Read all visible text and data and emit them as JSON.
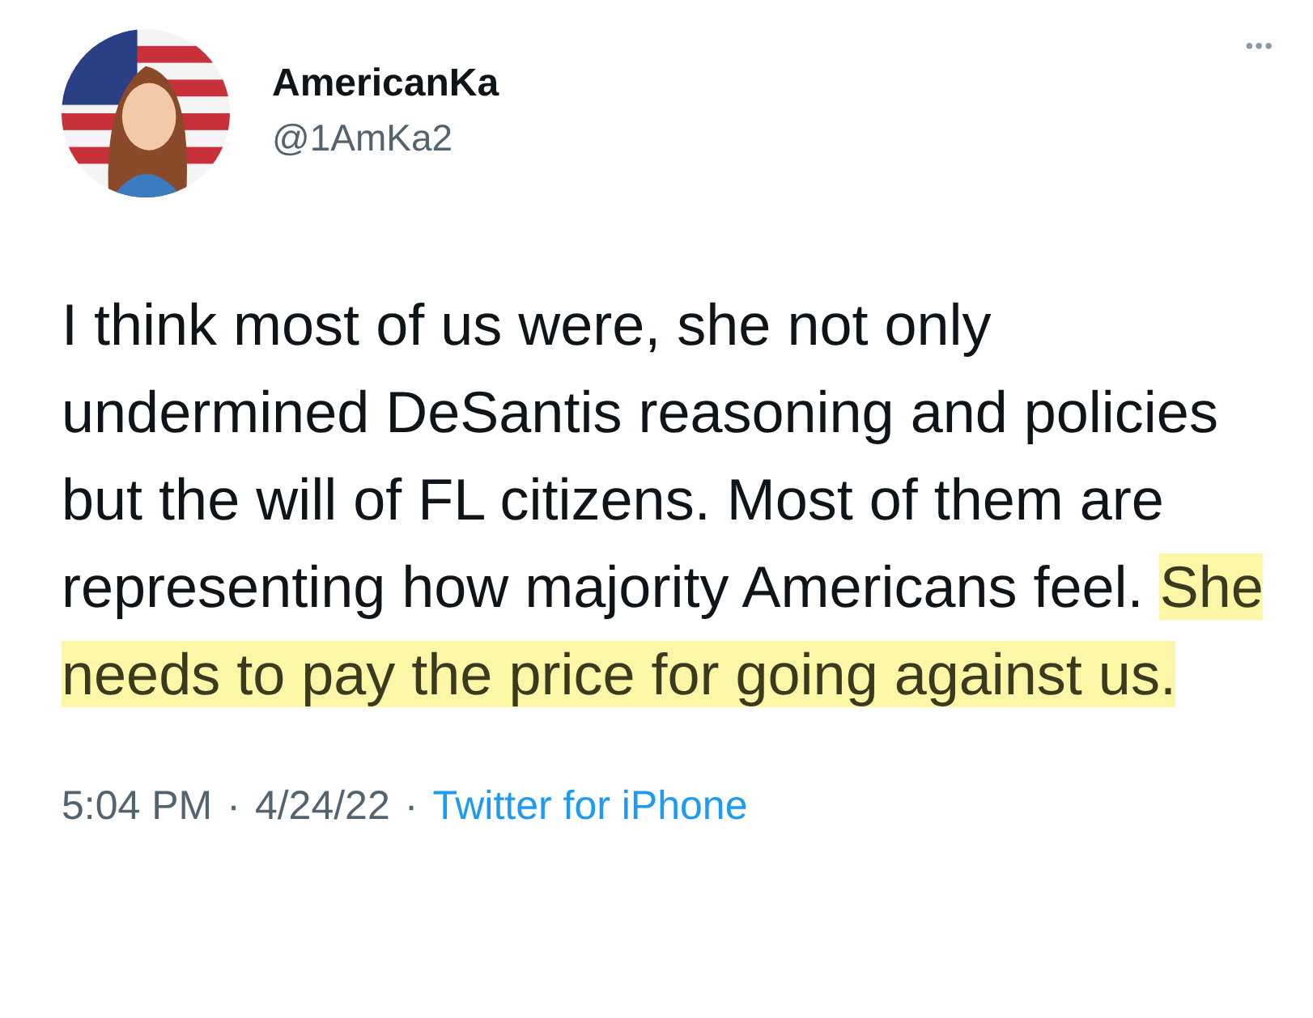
{
  "author": {
    "name": "AmericanKa",
    "handle": "@1AmKa2"
  },
  "more_button": "•••",
  "body": [
    {
      "text": "I think most of us were, she not only undermined DeSantis reasoning and policies but the will of FL citizens. Most of them are representing how majority Americans feel. ",
      "highlighted": false
    },
    {
      "text": "She needs to pay the price for going against us.",
      "highlighted": true
    }
  ],
  "meta": {
    "time": "5:04 PM",
    "separator_1": "·",
    "date": "4/24/22",
    "separator_2": "·",
    "source": "Twitter for iPhone"
  }
}
